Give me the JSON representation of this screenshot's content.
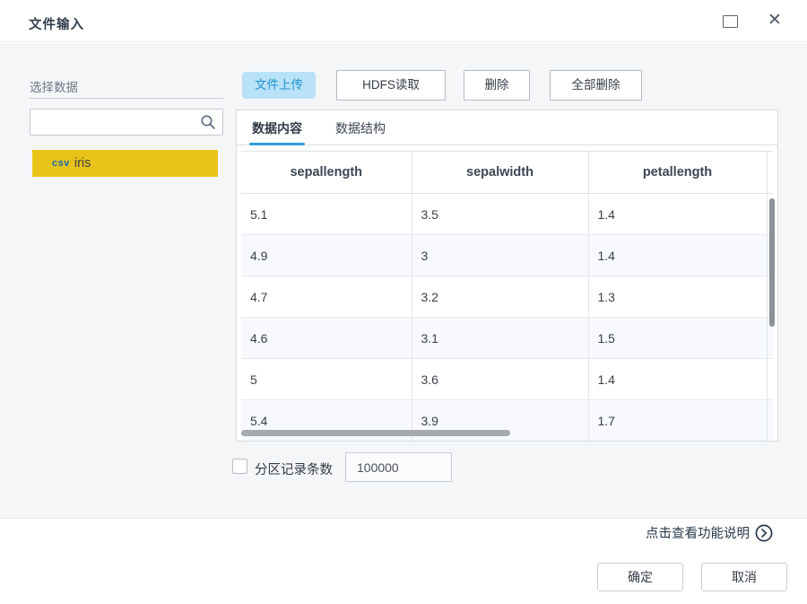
{
  "window": {
    "title": "文件输入"
  },
  "sidebar": {
    "section_label": "选择数据",
    "search_placeholder": "",
    "dataset": {
      "type": "csv",
      "name": "iris",
      "selected": true
    }
  },
  "toolbar": {
    "upload": "文件上传",
    "hdfs": "HDFS读取",
    "delete": "删除",
    "delete_all": "全部删除"
  },
  "tabs": {
    "content": "数据内容",
    "structure": "数据结构",
    "active": "数据内容"
  },
  "table": {
    "columns": [
      "sepallength",
      "sepalwidth",
      "petallength"
    ],
    "rows": [
      [
        "5.1",
        "3.5",
        "1.4"
      ],
      [
        "4.9",
        "3",
        "1.4"
      ],
      [
        "4.7",
        "3.2",
        "1.3"
      ],
      [
        "4.6",
        "3.1",
        "1.5"
      ],
      [
        "5",
        "3.6",
        "1.4"
      ],
      [
        "5.4",
        "3.9",
        "1.7"
      ]
    ]
  },
  "partition": {
    "label": "分区记录条数",
    "value": "100000",
    "checked": false
  },
  "footer": {
    "help": "点击查看功能说明",
    "ok": "确定",
    "cancel": "取消"
  },
  "colors": {
    "accent_blue": "#2e9fd9",
    "selected_yellow": "#e8c41a",
    "upload_bg": "#b9e1f7",
    "upload_text": "#1d93d2",
    "content_bg": "#f5f6f8"
  }
}
